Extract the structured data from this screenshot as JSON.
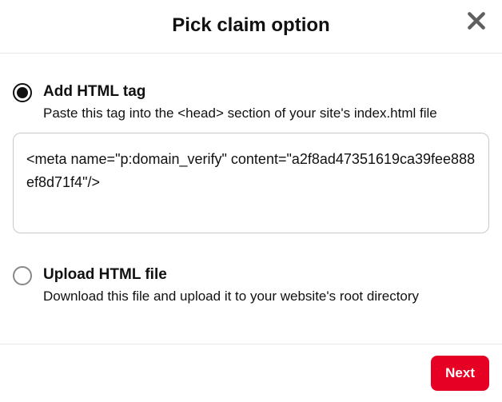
{
  "header": {
    "title": "Pick claim option"
  },
  "options": {
    "add_html_tag": {
      "title": "Add HTML tag",
      "description": "Paste this tag into the <head> section of your site's index.html file",
      "selected": true,
      "code": "<meta name=\"p:domain_verify\" content=\"a2f8ad47351619ca39fee888ef8d71f4\"/>"
    },
    "upload_html_file": {
      "title": "Upload HTML file",
      "description": "Download this file and upload it to your website's root directory",
      "selected": false
    }
  },
  "footer": {
    "next_label": "Next"
  }
}
